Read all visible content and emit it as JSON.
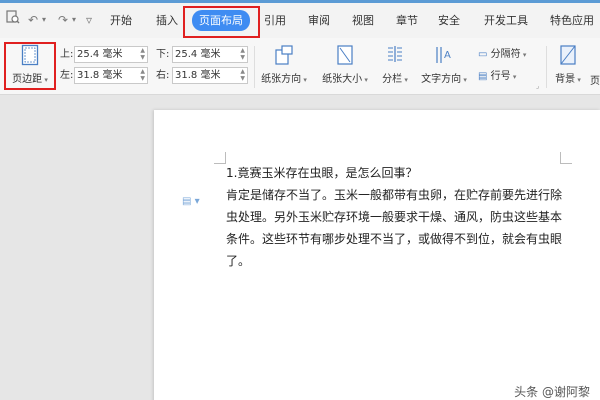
{
  "quick_access": {
    "preview_icon": "print-preview-icon",
    "undo_icon": "undo-icon",
    "redo_icon": "redo-icon",
    "more_icon": "dropdown-icon"
  },
  "menu": {
    "items": [
      "开始",
      "插入",
      "页面布局",
      "引用",
      "审阅",
      "视图",
      "章节",
      "安全",
      "开发工具",
      "特色应用"
    ],
    "active_index": 2
  },
  "ribbon": {
    "margins_button": "页边距",
    "top_label": "上:",
    "top_value": "25.4 毫米",
    "bottom_label": "下:",
    "bottom_value": "25.4 毫米",
    "left_label": "左:",
    "left_value": "31.8 毫米",
    "right_label": "右:",
    "right_value": "31.8 毫米",
    "orientation": "纸张方向",
    "size": "纸张大小",
    "columns": "分栏",
    "text_direction": "文字方向",
    "separator": "分隔符",
    "line_number": "行号",
    "background": "背景",
    "page_partial": "页"
  },
  "document": {
    "lines": [
      "1.竟赛玉米存在虫眼，是怎么回事？",
      "肯定是储存不当了。玉米一般都带有虫卵，在贮存前要先进行除",
      "虫处理。另外玉米贮存环境一般要求干燥、通风，防虫这些基本",
      "条件。这些环节有哪步处理不当了，或做得不到位，就会有虫眼",
      "了。"
    ]
  },
  "watermark": "头条 @谢阿黎",
  "colors": {
    "accent": "#3f8cf2",
    "highlight": "#e02020"
  }
}
